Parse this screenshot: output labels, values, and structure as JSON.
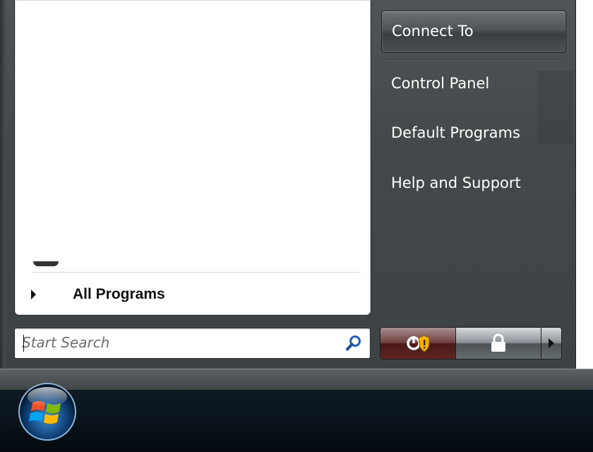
{
  "left_pane": {
    "all_programs_label": "All Programs"
  },
  "search": {
    "placeholder": "Start Search",
    "value": ""
  },
  "right_pane": {
    "items": [
      {
        "label": "Connect To",
        "highlighted": true
      },
      {
        "label": "Control Panel"
      },
      {
        "label": "Default Programs"
      },
      {
        "label": "Help and Support"
      }
    ]
  },
  "power_buttons": {
    "power_icon": "power-shield-icon",
    "lock_icon": "lock-icon",
    "arrow_icon": "arrow-right-icon"
  },
  "taskbar": {
    "start_orb_icon": "windows-logo-icon"
  },
  "colors": {
    "menu_background": "#43484b",
    "left_pane": "#ffffff",
    "taskbar": "#050b10",
    "power_button": "#6f4140"
  }
}
